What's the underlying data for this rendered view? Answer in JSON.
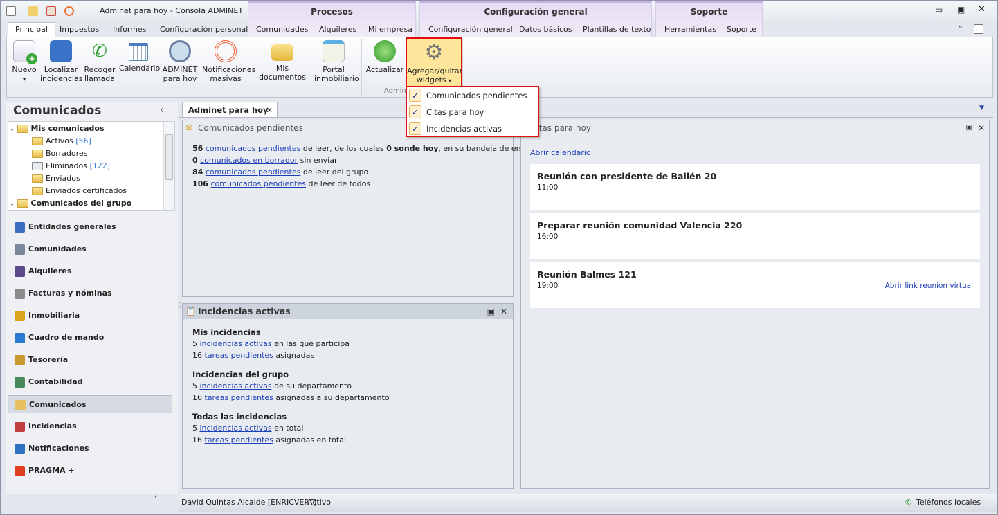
{
  "window": {
    "title": "Adminet para hoy - Consola ADMINET"
  },
  "context_groups": [
    {
      "label": "Procesos"
    },
    {
      "label": "Configuración general"
    },
    {
      "label": "Soporte"
    }
  ],
  "tabs": [
    "Principal",
    "Impuestos",
    "Informes",
    "Configuración personal",
    "Comunidades",
    "Alquileres",
    "Mi empresa",
    "Configuración general",
    "Datos básicos",
    "Plantillas de texto",
    "Herramientas",
    "Soporte"
  ],
  "ribbon": {
    "buttons": [
      {
        "label": "Nuevo"
      },
      {
        "label": "Localizar incidencias"
      },
      {
        "label": "Recoger llamada"
      },
      {
        "label": "Calendario"
      },
      {
        "label": "ADMINET para hoy"
      },
      {
        "label": "Notificaciones masivas"
      },
      {
        "label": "Mis documentos"
      },
      {
        "label": "Portal inmobiliario"
      },
      {
        "label": "Actualizar"
      },
      {
        "label": "Agregar/quitar widgets"
      }
    ],
    "group_label": "Admine"
  },
  "dropdown": {
    "items": [
      {
        "label": "Comunicados pendientes",
        "checked": true
      },
      {
        "label": "Citas para hoy",
        "checked": true
      },
      {
        "label": "Incidencias activas",
        "checked": true
      }
    ]
  },
  "left_panel": {
    "title": "Comunicados",
    "tree": [
      {
        "label": "Mis comunicados",
        "bold": true
      },
      {
        "label": "Activos",
        "count": "[56]"
      },
      {
        "label": "Borradores"
      },
      {
        "label": "Eliminados",
        "count": "[122]"
      },
      {
        "label": "Enviados"
      },
      {
        "label": "Enviados certificados"
      },
      {
        "label": "Comunicados del grupo",
        "bold": true
      }
    ],
    "nav": [
      {
        "label": "Entidades generales",
        "color": "#3b6fc4"
      },
      {
        "label": "Comunidades",
        "color": "#7a8a9a"
      },
      {
        "label": "Alquileres",
        "color": "#5a4a8a"
      },
      {
        "label": "Facturas y nóminas",
        "color": "#8a8a8a"
      },
      {
        "label": "Inmobiliaria",
        "color": "#d9a520"
      },
      {
        "label": "Cuadro de mando",
        "color": "#2a7ad0"
      },
      {
        "label": "Tesorería",
        "color": "#c89a30"
      },
      {
        "label": "Contabilidad",
        "color": "#4a8a5a"
      },
      {
        "label": "Comunicados",
        "color": "#e8c060",
        "selected": true
      },
      {
        "label": "Incidencias",
        "color": "#c04040"
      },
      {
        "label": "Notificaciones",
        "color": "#3070c0"
      },
      {
        "label": "PRAGMA +",
        "color": "#e04020"
      }
    ]
  },
  "doc_tab": {
    "label": "Adminet para hoy"
  },
  "comunicados": {
    "title": "Comunicados pendientes",
    "l1": {
      "n": "56",
      "link": "comunicados pendientes",
      "t1": " de leer, de los cuales ",
      "b": "0 sonde hoy",
      "t2": ", en su bandeja de entrada"
    },
    "l2": {
      "n": "0",
      "link": "comunicados en borrador",
      "t": " sin enviar"
    },
    "l3": {
      "n": "84",
      "link": "comunicados pendientes",
      "t": " de leer del grupo"
    },
    "l4": {
      "n": "106",
      "link": "comunicados pendientes",
      "t": " de leer de todos"
    }
  },
  "incidencias": {
    "title": "Incidencias activas",
    "sections": [
      {
        "h": "Mis incidencias",
        "a": {
          "n": "5",
          "link": "incidencias activas",
          "t": " en las que participa"
        },
        "b": {
          "n": "16",
          "link": "tareas pendientes",
          "t": " asignadas"
        }
      },
      {
        "h": "Incidencias del grupo",
        "a": {
          "n": "5",
          "link": "incidencias activas",
          "t": " de su departamento"
        },
        "b": {
          "n": "16",
          "link": "tareas pendientes",
          "t": " asignadas a su departamento"
        }
      },
      {
        "h": "Todas las incidencias",
        "a": {
          "n": "5",
          "link": "incidencias activas",
          "t": " en total"
        },
        "b": {
          "n": "16",
          "link": "tareas pendientes",
          "t": " asignadas en total"
        }
      }
    ]
  },
  "citas": {
    "title": "Citas para hoy",
    "open_calendar": "Abrir calendario",
    "items": [
      {
        "title": "Reunión con presidente de Bailén 20",
        "time": "11:00"
      },
      {
        "title": "Preparar reunión comunidad Valencia 220",
        "time": "16:00"
      },
      {
        "title": "Reunión Balmes 121",
        "time": "19:00",
        "link": "Abrir link reunión virtual"
      }
    ]
  },
  "status": {
    "user": "David Quintas Alcalde [ENRICVERT]",
    "state": "Activo",
    "phones": "Teléfonos locales"
  }
}
